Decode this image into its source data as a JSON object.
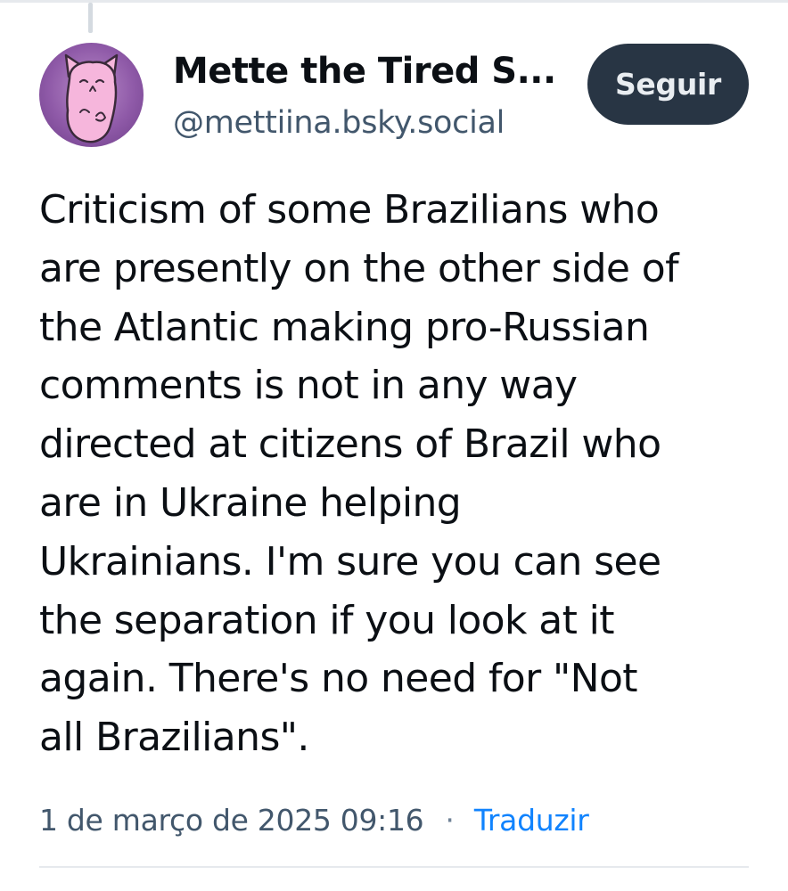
{
  "post": {
    "author": {
      "display_name": "Mette the Tired S...",
      "handle": "@mettiina.bsky.social",
      "avatar_icon": "pink-cat-avatar"
    },
    "follow_label": "Seguir",
    "text": "Criticism of some Brazilians who\nare presently on the other side of\nthe Atlantic making pro-Russian\ncomments is not in any way\ndirected at citizens of Brazil who\nare in Ukraine helping\nUkrainians. I'm sure you can see\nthe separation if you look at it\nagain. There's no need for \"Not\nall Brazilians\".",
    "timestamp": "1 de março de 2025 09:16",
    "separator": "·",
    "translate_label": "Traduzir"
  },
  "colors": {
    "follow_button_bg": "#283544",
    "link": "#1083fe",
    "muted_text": "#42576c",
    "avatar_bg": "#8f5aa8"
  }
}
